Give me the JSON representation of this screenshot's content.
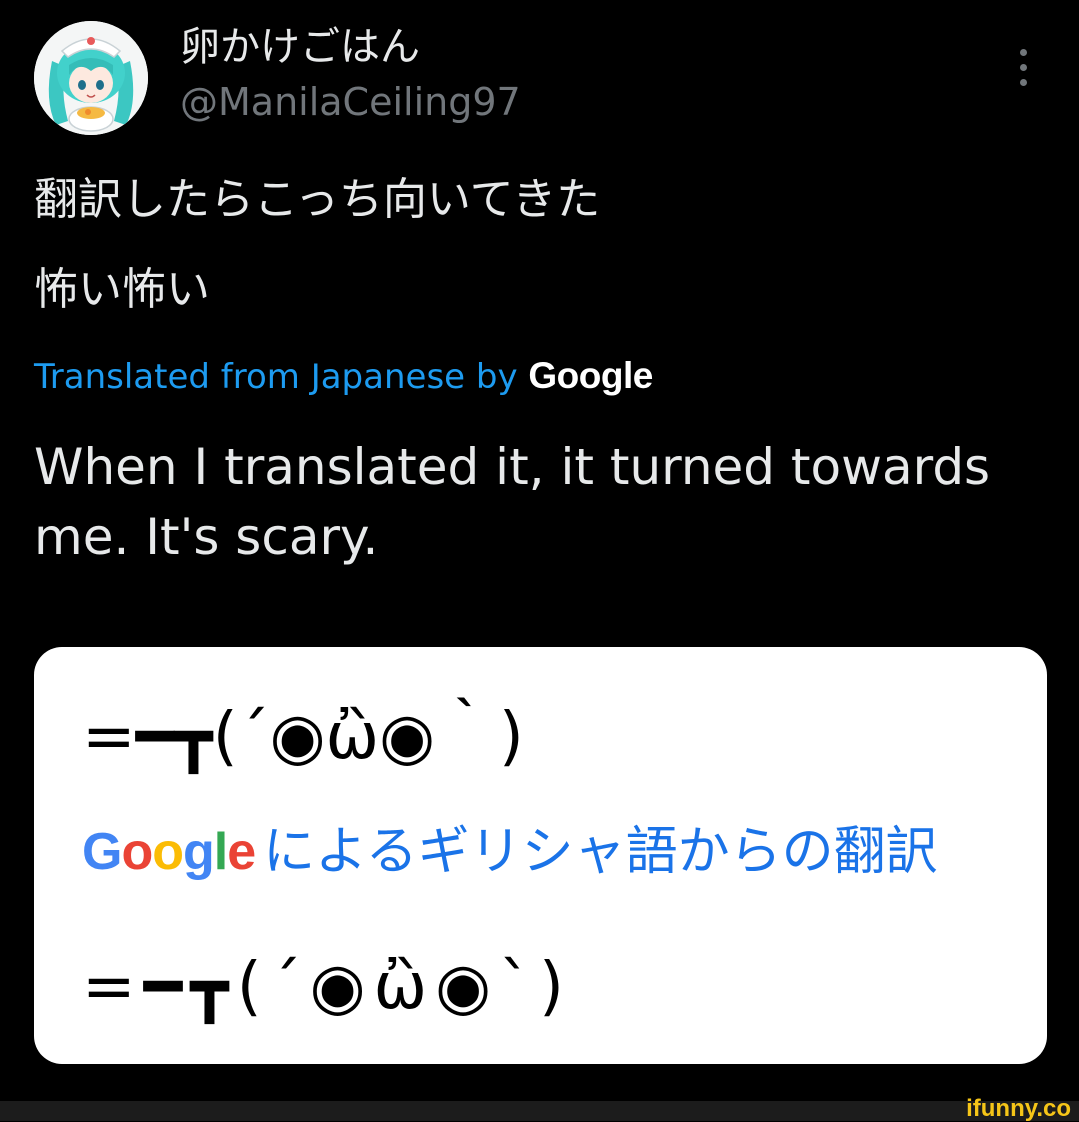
{
  "tweet": {
    "author": {
      "display_name": "卵かけごはん",
      "handle": "@ManilaCeiling97",
      "avatar_icon": "anime-avatar-icon"
    },
    "more_icon": "more-vertical-icon",
    "text_lines": [
      "翻訳したらこっち向いてきた",
      "怖い怖い"
    ],
    "translation_note": {
      "label": "Translated from Japanese by",
      "brand": "Google"
    },
    "translated_text": "When I translated it, it turned towards me. It's scary.",
    "media": {
      "kaomoji_top": "=━┳(´◉ὢ◉｀)",
      "google_logo": [
        "G",
        "o",
        "o",
        "g",
        "l",
        "e"
      ],
      "caption": "によるギリシャ語からの翻訳",
      "kaomoji_bottom": "=━┳(´◉ὢ◉`)"
    }
  },
  "watermark": "ifunny.co",
  "colors": {
    "background": "#000000",
    "text": "#e7e9ea",
    "muted": "#71767b",
    "link": "#1d9bf0",
    "card": "#ffffff",
    "google_blue": "#4285f4",
    "google_red": "#ea4335",
    "google_yellow": "#fbbc05",
    "google_green": "#34a853",
    "watermark": "#f5c518"
  }
}
